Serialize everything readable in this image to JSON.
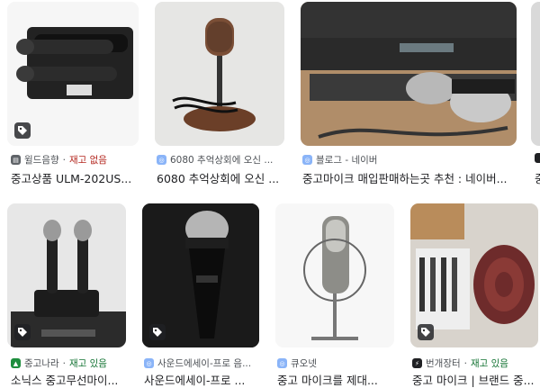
{
  "results": [
    {
      "source": "윌드음향",
      "stock": "재고 없음",
      "title": "중고상품 ULM-202US..."
    },
    {
      "source": "6080 추억상회에 오신 ...",
      "stock": "",
      "title": "6080 추억상회에 오신 ..."
    },
    {
      "source": "블로그 - 네이버",
      "stock": "",
      "title": "중고마이크 매입판매하는곳 추천 : 네이버..."
    },
    {
      "source": "",
      "stock": "",
      "title": "중"
    },
    {
      "source": "중고나라",
      "stock": "재고 있음",
      "title": "소닉스 중고무선마이..."
    },
    {
      "source": "사운드에세이-프로 음...",
      "stock": "",
      "title": "사운드에세이-프로 ..."
    },
    {
      "source": "큐오넷",
      "stock": "",
      "title": "중고 마이크를 제대..."
    },
    {
      "source": "번개장터",
      "stock": "재고 있음",
      "title": "중고 마이크 | 브랜드 중..."
    }
  ],
  "separator": " · ",
  "icons": {
    "tag": "tag-icon",
    "globe": "globe-icon"
  }
}
